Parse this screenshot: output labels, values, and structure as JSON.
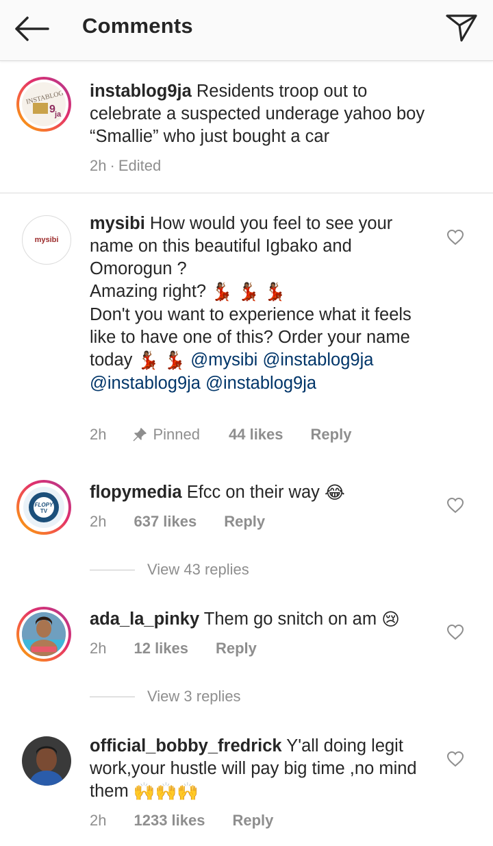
{
  "header": {
    "back_icon": "arrow-left-icon",
    "title": "Comments",
    "direct_icon": "paper-plane-icon"
  },
  "caption": {
    "username": "instablog9ja",
    "text": "Residents troop out to celebrate a suspected underage yahoo boy “Smallie” who just bought a car",
    "time": "2h",
    "edited": "Edited",
    "avatar_text": "INSTABLOG 9ja"
  },
  "comments": [
    {
      "username": "mysibi",
      "avatar_text": "mysibi",
      "line1": "How would you feel to see your name on this beautiful Igbako  and Omorogun ?",
      "line2": "Amazing right?",
      "line3": "Don't you want to experience what it feels like to have one of this? Order your name today",
      "mentions": [
        "@mysibi",
        "@instablog9ja",
        "@instablog9ja",
        "@instablog9ja"
      ],
      "time": "2h",
      "pinned": "Pinned",
      "likes": "44 likes",
      "reply": "Reply"
    },
    {
      "username": "flopymedia",
      "avatar_text": "FLOPY TV",
      "text": "Efcc on their way",
      "time": "2h",
      "likes": "637 likes",
      "reply": "Reply",
      "view_replies": "View 43 replies"
    },
    {
      "username": "ada_la_pinky",
      "text": "Them go snitch on am",
      "time": "2h",
      "likes": "12 likes",
      "reply": "Reply",
      "view_replies": "View 3 replies"
    },
    {
      "username": "official_bobby_fredrick",
      "text": "Y'all doing legit work,your hustle will pay big time ,no mind them",
      "time": "2h",
      "likes": "1233 likes",
      "reply": "Reply"
    }
  ],
  "colors": {
    "text": "#262626",
    "secondary": "#8e8e8e",
    "mention": "#003569",
    "divider": "#dbdbdb"
  }
}
